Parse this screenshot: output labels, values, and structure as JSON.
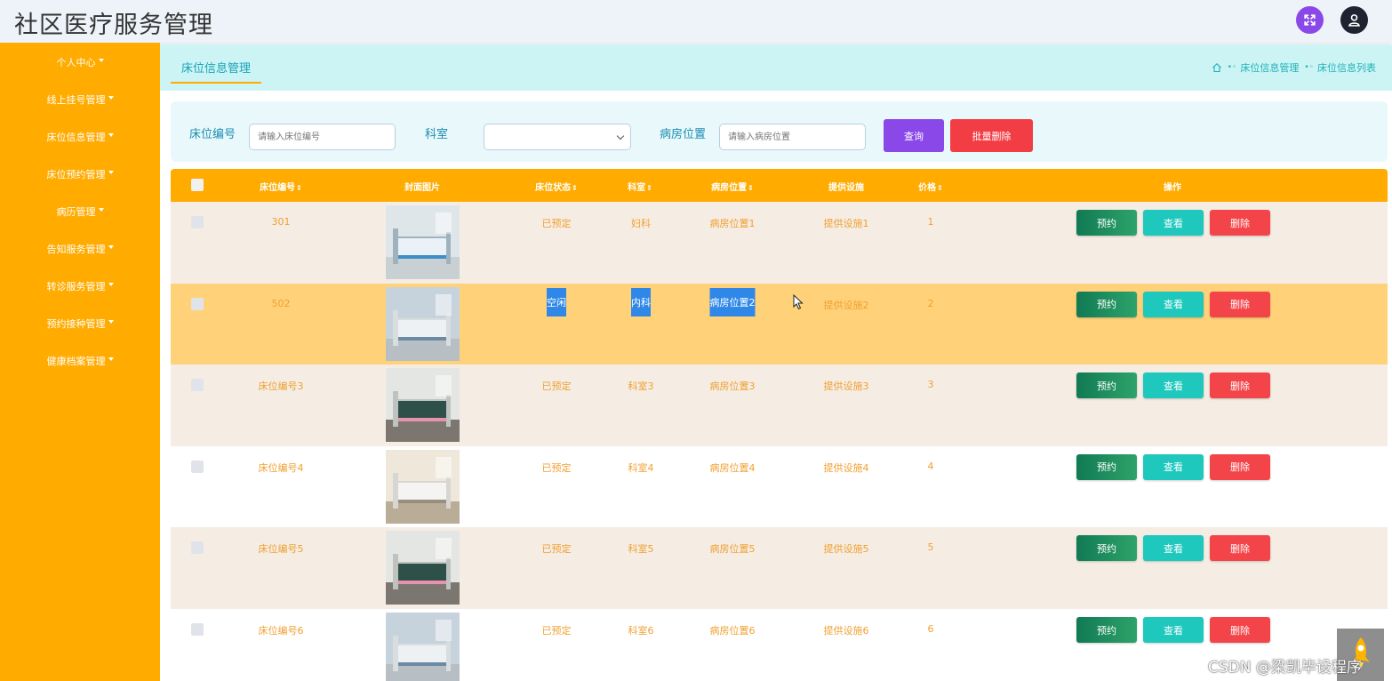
{
  "header": {
    "title": "社区医疗服务管理"
  },
  "sidebar": {
    "items": [
      {
        "label": "个人中心"
      },
      {
        "label": "线上挂号管理"
      },
      {
        "label": "床位信息管理"
      },
      {
        "label": "床位预约管理"
      },
      {
        "label": "病历管理"
      },
      {
        "label": "告知服务管理"
      },
      {
        "label": "转诊服务管理"
      },
      {
        "label": "预约接种管理"
      },
      {
        "label": "健康档案管理"
      }
    ]
  },
  "tabs": {
    "active": "床位信息管理"
  },
  "breadcrumb": {
    "items": [
      "床位信息管理",
      "床位信息列表"
    ]
  },
  "search": {
    "bed_no_label": "床位编号",
    "bed_no_placeholder": "请输入床位编号",
    "dept_label": "科室",
    "dept_value": "",
    "location_label": "病房位置",
    "location_placeholder": "请输入病房位置",
    "query_button": "查询",
    "batch_delete_button": "批量删除"
  },
  "table": {
    "columns": {
      "bed_no": "床位编号",
      "image": "封面图片",
      "status": "床位状态",
      "dept": "科室",
      "location": "病房位置",
      "facility": "提供设施",
      "price": "价格",
      "actions": "操作"
    },
    "sort_icon": "⇕",
    "actions": {
      "book": "预约",
      "view": "查看",
      "delete": "删除"
    },
    "rows": [
      {
        "bed_no": "301",
        "status": "已预定",
        "dept": "妇科",
        "location": "病房位置1",
        "facility": "提供设施1",
        "price": "1",
        "bg": "#f5ede4"
      },
      {
        "bed_no": "502",
        "status": "空闲",
        "dept": "内科",
        "location": "病房位置2",
        "facility": "提供设施2",
        "price": "2",
        "bg": "#ffd27a",
        "selected": true
      },
      {
        "bed_no": "床位编号3",
        "status": "已预定",
        "dept": "科室3",
        "location": "病房位置3",
        "facility": "提供设施3",
        "price": "3",
        "bg": "#f5ede4"
      },
      {
        "bed_no": "床位编号4",
        "status": "已预定",
        "dept": "科室4",
        "location": "病房位置4",
        "facility": "提供设施4",
        "price": "4",
        "bg": "#ffffff"
      },
      {
        "bed_no": "床位编号5",
        "status": "已预定",
        "dept": "科室5",
        "location": "病房位置5",
        "facility": "提供设施5",
        "price": "5",
        "bg": "#f5ede4"
      },
      {
        "bed_no": "床位编号6",
        "status": "已预定",
        "dept": "科室6",
        "location": "病房位置6",
        "facility": "提供设施6",
        "price": "6",
        "bg": "#ffffff"
      }
    ]
  },
  "watermark": "CSDN @梁凯毕设程序",
  "colors": {
    "sidebar": "#ffab00",
    "accent_purple": "#8b48e8",
    "danger": "#f33d44",
    "teal": "#1fc8bd",
    "green": "#117a54"
  },
  "icons": {
    "fullscreen": "fullscreen-icon",
    "user": "user-icon",
    "home": "home-icon",
    "back_to_top": "rocket-icon"
  }
}
